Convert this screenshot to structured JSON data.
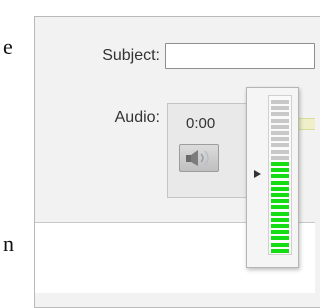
{
  "background": {
    "letter_top": "e",
    "letter_bottom": "n"
  },
  "form": {
    "subject_label": "Subject:",
    "subject_value": "",
    "audio_label": "Audio:"
  },
  "audio_player": {
    "time": "0:00",
    "speaker_icon": "speaker-icon",
    "volume_level": 0.6,
    "volume_segments": 25,
    "colors": {
      "active": "#14dd14",
      "inactive": "#c8c8c8"
    }
  }
}
